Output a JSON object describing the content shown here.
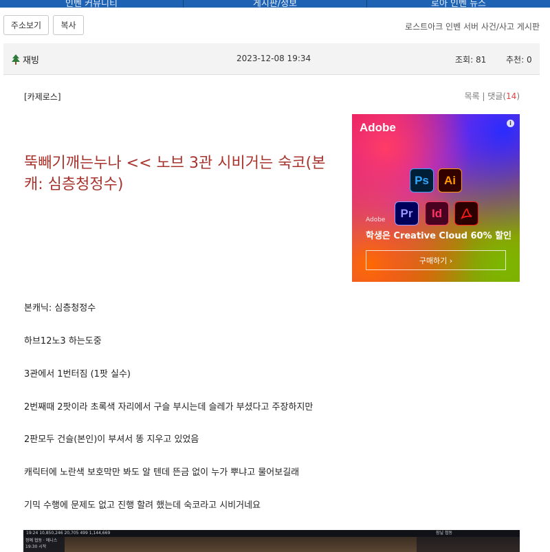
{
  "nav": {
    "tabs": [
      "인벤 커뮤니티",
      "게시판/정보",
      "로아 인벤 뉴스"
    ]
  },
  "toolbar": {
    "address_label": "주소보기",
    "copy_label": "복사"
  },
  "board": {
    "name": "로스트아크 인벤 서버 사건/사고 게시판"
  },
  "post": {
    "author": "재빙",
    "date": "2023-12-08 19:34",
    "views_label": "조회: 81",
    "recommend_label": "추천: 0",
    "category": "[카제로스]",
    "list_label": "목록",
    "separator": "|",
    "comment_label": "댓글(",
    "comment_count": "14",
    "comment_close": ")",
    "title": "뚝빼기깨는누나 << 노브 3관 시비거는 숙코(본캐: 심층청정수)",
    "lines": [
      "본캐닉: 심층청정수",
      "하브12노3 하는도중",
      "3관에서 1번터짐 (1팟 실수)",
      "2번째때 2팟이라 초록색 자리에서 구슬 부시는데 슬레가 부셨다고 주장하지만",
      "2판모두 건슬(본인)이 부셔서 똥 지우고 있었음",
      "캐릭터에 노란색 보호막만 봐도 알 텐데 뜬금 없이 누가 뿌냐고 물어보길래",
      "기믹 수행에 문제도 없고 진행 할려 했는데 숙코라고 시비거네요"
    ]
  },
  "ad": {
    "brand": "Adobe",
    "info": "i",
    "apps": [
      "Ps",
      "Ai",
      "Pr",
      "Id"
    ],
    "small_brand": "Adobe",
    "headline": "학생은 Creative Cloud 60% 할인",
    "cta": "구매하기 ›"
  },
  "game": {
    "hud": "19:24   10,850,246   20,705   499   1,144,669",
    "panel": "정예 협동 · 에니스",
    "panel_time": "19:30 시작",
    "right": "잠닐 협동"
  },
  "colors": {
    "nav_blue": "#1e62b4",
    "title_red": "#a8332c",
    "comment_red": "#dd4444"
  }
}
